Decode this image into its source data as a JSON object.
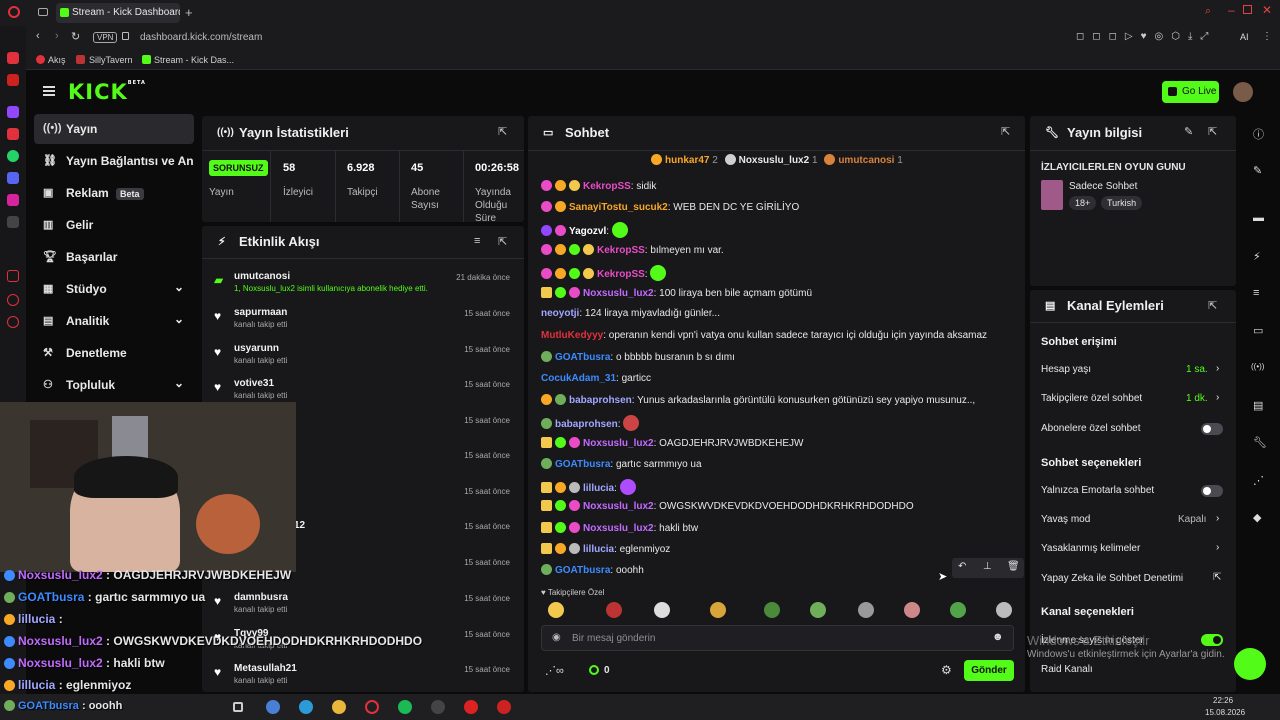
{
  "browser": {
    "tab_title": "Stream - Kick Dashboard",
    "vpn_label": "VPN",
    "url": "dashboard.kick.com/stream",
    "bookmarks": [
      "Akış",
      "SillyTavern",
      "Stream - Kick Das..."
    ],
    "right_label": "AI"
  },
  "header": {
    "logo": "KICK",
    "logo_sup": "BETA",
    "go_live": "Go Live"
  },
  "nav": [
    {
      "label": "Yayın",
      "icon": "broadcast-icon"
    },
    {
      "label": "Yayın Bağlantısı ve Anahtarı",
      "icon": "link-icon"
    },
    {
      "label": "Reklam",
      "badge": "Beta",
      "icon": "ad-icon"
    },
    {
      "label": "Gelir",
      "icon": "revenue-icon"
    },
    {
      "label": "Başarılar",
      "icon": "trophy-icon"
    },
    {
      "label": "Stüdyo",
      "icon": "studio-icon"
    },
    {
      "label": "Analitik",
      "icon": "analytics-icon"
    },
    {
      "label": "Denetleme",
      "icon": "moderation-icon"
    },
    {
      "label": "Topluluk",
      "icon": "community-icon"
    }
  ],
  "stats": {
    "title": "Yayın İstatistikleri",
    "status": "SORUNSUZ",
    "status_label": "Yayın",
    "items": [
      {
        "value": "58",
        "label": "İzleyici"
      },
      {
        "value": "6.928",
        "label": "Takipçi"
      },
      {
        "value": "45",
        "label": "Abone Sayısı"
      },
      {
        "value": "00:26:58",
        "label": "Yayında Olduğu Süre"
      }
    ]
  },
  "activity": {
    "title": "Etkinlik Akışı",
    "items": [
      {
        "name": "umutcanosi",
        "desc": "1, Noxsuslu_lux2 isimli kullanıcıya abonelik hediye etti.",
        "time": "21 dakika önce"
      },
      {
        "name": "sapurmaan",
        "desc": "kanalı takip etti",
        "time": "15 saat önce"
      },
      {
        "name": "usyarunn",
        "desc": "kanalı takip etti",
        "time": "15 saat önce"
      },
      {
        "name": "votive31",
        "desc": "kanalı takip etti",
        "time": "15 saat önce"
      },
      {
        "name": "",
        "desc": "",
        "time": "15 saat önce"
      },
      {
        "name": "",
        "desc": "",
        "time": "15 saat önce"
      },
      {
        "name": "",
        "desc": "",
        "time": "15 saat önce"
      },
      {
        "name": "12",
        "desc": "",
        "time": "15 saat önce"
      },
      {
        "name": "",
        "desc": "",
        "time": "15 saat önce"
      },
      {
        "name": "damnbusra",
        "desc": "kanalı takip etti",
        "time": "15 saat önce"
      },
      {
        "name": "Tqvy99",
        "desc": "kanalı takip etti",
        "time": "15 saat önce"
      },
      {
        "name": "Metasullah21",
        "desc": "kanalı takip etti",
        "time": "15 saat önce"
      }
    ]
  },
  "chat": {
    "title": "Sohbet",
    "top_gifters": [
      {
        "name": "hunkar47",
        "count": "2"
      },
      {
        "name": "Noxsuslu_lux2",
        "count": "1"
      },
      {
        "name": "umutcanosi",
        "count": "1"
      }
    ],
    "messages": [
      {
        "user": "KekropSS",
        "text": ": sidik",
        "color": "#e94cc6"
      },
      {
        "user": "SanayiTostu_sucuk2",
        "text": ": WEB DEN DC YE GİRİLİYO",
        "color": "#f9a825"
      },
      {
        "user": "Yagozvl",
        "text": ":",
        "color": "#ffffff"
      },
      {
        "user": "KekropSS",
        "text": ": bılmeyen mı var.",
        "color": "#e94cc6"
      },
      {
        "user": "KekropSS",
        "text": ":",
        "color": "#e94cc6"
      },
      {
        "user": "Noxsuslu_lux2",
        "text": ": 100 liraya ben bile açmam götümü",
        "color": "#c26bff"
      },
      {
        "user": "neoyotji",
        "text": ": 124 liraya miyavladığı günler...",
        "color": "#a2a7ff"
      },
      {
        "user": "MutluKedyyy",
        "text": ": operanın kendi vpn'i vatya onu kullan sadece tarayıcı içi olduğu için yayında aksamaz",
        "color": "#e0313c"
      },
      {
        "user": "GOATbusra",
        "text": ": o bbbbb busranın b sı dımı",
        "color": "#3d8bff"
      },
      {
        "user": "CocukAdam_31",
        "text": ": garticc",
        "color": "#3d8bff"
      },
      {
        "user": "babaprohsen",
        "text": ": Yunus arkadaslarınla görüntülü konusurken götünüzü sey yapiyo musunuz..,",
        "color": "#a2a7ff"
      },
      {
        "user": "babaprohsen",
        "text": ":",
        "color": "#a2a7ff"
      },
      {
        "user": "Noxsuslu_lux2",
        "text": ": OAGDJEHRJRVJWBDKEHEJW",
        "color": "#c26bff"
      },
      {
        "user": "GOATbusra",
        "text": ": gartıc sarmmıyo ua",
        "color": "#3d8bff"
      },
      {
        "user": "lillucia",
        "text": ":",
        "color": "#a2a7ff"
      },
      {
        "user": "Noxsuslu_lux2",
        "text": ": OWGSKWVDKEVDKDVOEHDODHDKRHKRHDODHDO",
        "color": "#c26bff"
      },
      {
        "user": "Noxsuslu_lux2",
        "text": ": hakli btw",
        "color": "#c26bff"
      },
      {
        "user": "lillucia",
        "text": ": eglenmiyoz",
        "color": "#a2a7ff"
      },
      {
        "user": "GOATbusra",
        "text": ": ooohh",
        "color": "#3d8bff"
      }
    ],
    "followers_only": "Takipçilere Özel",
    "input_placeholder": "Bir mesaj gönderin",
    "points": "0",
    "send": "Gönder"
  },
  "stream_info": {
    "title": "Yayın bilgisi",
    "stream_title": "İZLAYICILERLEN OYUN GUNU",
    "category": "Sadece Sohbet",
    "tags": [
      "18+",
      "Turkish"
    ]
  },
  "channel_actions": {
    "title": "Kanal Eylemleri",
    "chat_access": "Sohbet erişimi",
    "account_age": {
      "label": "Hesap yaşı",
      "value": "1 sa."
    },
    "followers_chat": {
      "label": "Takipçilere özel sohbet",
      "value": "1 dk."
    },
    "subs_chat": {
      "label": "Abonelere özel sohbet"
    },
    "chat_options": "Sohbet seçenekleri",
    "emote_only": {
      "label": "Yalnızca Emotarla sohbet"
    },
    "slow_mode": {
      "label": "Yavaş mod",
      "value": "Kapalı"
    },
    "banned_words": {
      "label": "Yasaklanmış kelimeler"
    },
    "ai_mod": {
      "label": "Yapay Zeka ile Sohbet Denetimi"
    },
    "channel_options": "Kanal seçenekleri",
    "show_viewers": {
      "label": "İzlenme sayısını göster"
    },
    "raid": {
      "label": "Raid Kanalı"
    }
  },
  "overlay_chat": [
    {
      "user": "Noxsuslu_lux2",
      "text": " : OAGDJEHRJRVJWBDKEHEJW",
      "color": "#c26bff"
    },
    {
      "user": "GOATbusra",
      "text": " : gartıc sarmmıyo ua",
      "color": "#3d8bff"
    },
    {
      "user": "lillucia",
      "text": " :",
      "color": "#a2a7ff"
    },
    {
      "user": "Noxsuslu_lux2",
      "text": " : OWGSKWVDKEVDKDVOEHDODHDKRHKRHDODHDO",
      "color": "#c26bff"
    },
    {
      "user": "Noxsuslu_lux2",
      "text": " : hakli btw",
      "color": "#c26bff"
    },
    {
      "user": "lillucia",
      "text": " : eglenmiyoz",
      "color": "#a2a7ff"
    },
    {
      "user": "GOATbusra",
      "text": " : ooohh",
      "color": "#3d8bff"
    }
  ],
  "watermark": {
    "line1": "Windows'u Etkinleştir",
    "line2": "Windows'u etkinleştirmek için Ayarlar'a gidin."
  },
  "taskbar": {
    "time": "22:26",
    "date": "15.08.2026"
  }
}
